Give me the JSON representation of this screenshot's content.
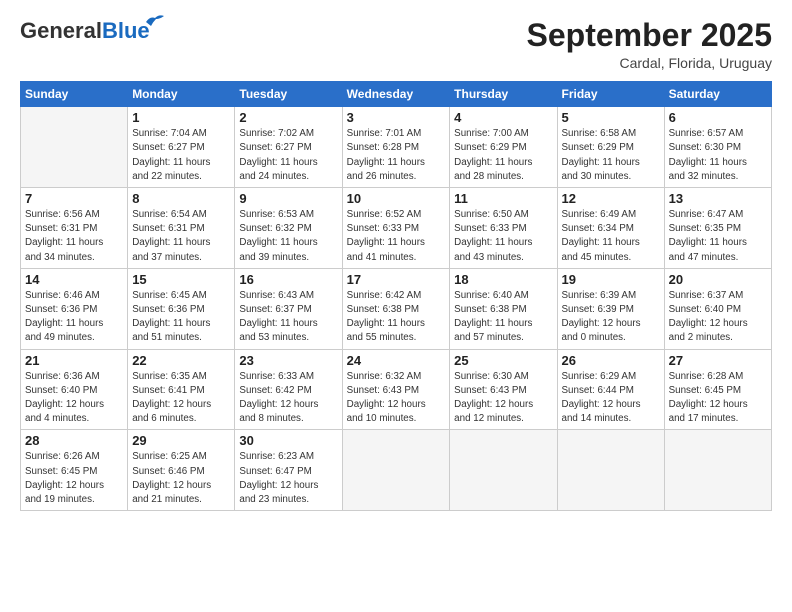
{
  "logo": {
    "general": "General",
    "blue": "Blue"
  },
  "title": "September 2025",
  "location": "Cardal, Florida, Uruguay",
  "days_header": [
    "Sunday",
    "Monday",
    "Tuesday",
    "Wednesday",
    "Thursday",
    "Friday",
    "Saturday"
  ],
  "weeks": [
    [
      {
        "day": "",
        "info": ""
      },
      {
        "day": "1",
        "info": "Sunrise: 7:04 AM\nSunset: 6:27 PM\nDaylight: 11 hours\nand 22 minutes."
      },
      {
        "day": "2",
        "info": "Sunrise: 7:02 AM\nSunset: 6:27 PM\nDaylight: 11 hours\nand 24 minutes."
      },
      {
        "day": "3",
        "info": "Sunrise: 7:01 AM\nSunset: 6:28 PM\nDaylight: 11 hours\nand 26 minutes."
      },
      {
        "day": "4",
        "info": "Sunrise: 7:00 AM\nSunset: 6:29 PM\nDaylight: 11 hours\nand 28 minutes."
      },
      {
        "day": "5",
        "info": "Sunrise: 6:58 AM\nSunset: 6:29 PM\nDaylight: 11 hours\nand 30 minutes."
      },
      {
        "day": "6",
        "info": "Sunrise: 6:57 AM\nSunset: 6:30 PM\nDaylight: 11 hours\nand 32 minutes."
      }
    ],
    [
      {
        "day": "7",
        "info": "Sunrise: 6:56 AM\nSunset: 6:31 PM\nDaylight: 11 hours\nand 34 minutes."
      },
      {
        "day": "8",
        "info": "Sunrise: 6:54 AM\nSunset: 6:31 PM\nDaylight: 11 hours\nand 37 minutes."
      },
      {
        "day": "9",
        "info": "Sunrise: 6:53 AM\nSunset: 6:32 PM\nDaylight: 11 hours\nand 39 minutes."
      },
      {
        "day": "10",
        "info": "Sunrise: 6:52 AM\nSunset: 6:33 PM\nDaylight: 11 hours\nand 41 minutes."
      },
      {
        "day": "11",
        "info": "Sunrise: 6:50 AM\nSunset: 6:33 PM\nDaylight: 11 hours\nand 43 minutes."
      },
      {
        "day": "12",
        "info": "Sunrise: 6:49 AM\nSunset: 6:34 PM\nDaylight: 11 hours\nand 45 minutes."
      },
      {
        "day": "13",
        "info": "Sunrise: 6:47 AM\nSunset: 6:35 PM\nDaylight: 11 hours\nand 47 minutes."
      }
    ],
    [
      {
        "day": "14",
        "info": "Sunrise: 6:46 AM\nSunset: 6:36 PM\nDaylight: 11 hours\nand 49 minutes."
      },
      {
        "day": "15",
        "info": "Sunrise: 6:45 AM\nSunset: 6:36 PM\nDaylight: 11 hours\nand 51 minutes."
      },
      {
        "day": "16",
        "info": "Sunrise: 6:43 AM\nSunset: 6:37 PM\nDaylight: 11 hours\nand 53 minutes."
      },
      {
        "day": "17",
        "info": "Sunrise: 6:42 AM\nSunset: 6:38 PM\nDaylight: 11 hours\nand 55 minutes."
      },
      {
        "day": "18",
        "info": "Sunrise: 6:40 AM\nSunset: 6:38 PM\nDaylight: 11 hours\nand 57 minutes."
      },
      {
        "day": "19",
        "info": "Sunrise: 6:39 AM\nSunset: 6:39 PM\nDaylight: 12 hours\nand 0 minutes."
      },
      {
        "day": "20",
        "info": "Sunrise: 6:37 AM\nSunset: 6:40 PM\nDaylight: 12 hours\nand 2 minutes."
      }
    ],
    [
      {
        "day": "21",
        "info": "Sunrise: 6:36 AM\nSunset: 6:40 PM\nDaylight: 12 hours\nand 4 minutes."
      },
      {
        "day": "22",
        "info": "Sunrise: 6:35 AM\nSunset: 6:41 PM\nDaylight: 12 hours\nand 6 minutes."
      },
      {
        "day": "23",
        "info": "Sunrise: 6:33 AM\nSunset: 6:42 PM\nDaylight: 12 hours\nand 8 minutes."
      },
      {
        "day": "24",
        "info": "Sunrise: 6:32 AM\nSunset: 6:43 PM\nDaylight: 12 hours\nand 10 minutes."
      },
      {
        "day": "25",
        "info": "Sunrise: 6:30 AM\nSunset: 6:43 PM\nDaylight: 12 hours\nand 12 minutes."
      },
      {
        "day": "26",
        "info": "Sunrise: 6:29 AM\nSunset: 6:44 PM\nDaylight: 12 hours\nand 14 minutes."
      },
      {
        "day": "27",
        "info": "Sunrise: 6:28 AM\nSunset: 6:45 PM\nDaylight: 12 hours\nand 17 minutes."
      }
    ],
    [
      {
        "day": "28",
        "info": "Sunrise: 6:26 AM\nSunset: 6:45 PM\nDaylight: 12 hours\nand 19 minutes."
      },
      {
        "day": "29",
        "info": "Sunrise: 6:25 AM\nSunset: 6:46 PM\nDaylight: 12 hours\nand 21 minutes."
      },
      {
        "day": "30",
        "info": "Sunrise: 6:23 AM\nSunset: 6:47 PM\nDaylight: 12 hours\nand 23 minutes."
      },
      {
        "day": "",
        "info": ""
      },
      {
        "day": "",
        "info": ""
      },
      {
        "day": "",
        "info": ""
      },
      {
        "day": "",
        "info": ""
      }
    ]
  ]
}
